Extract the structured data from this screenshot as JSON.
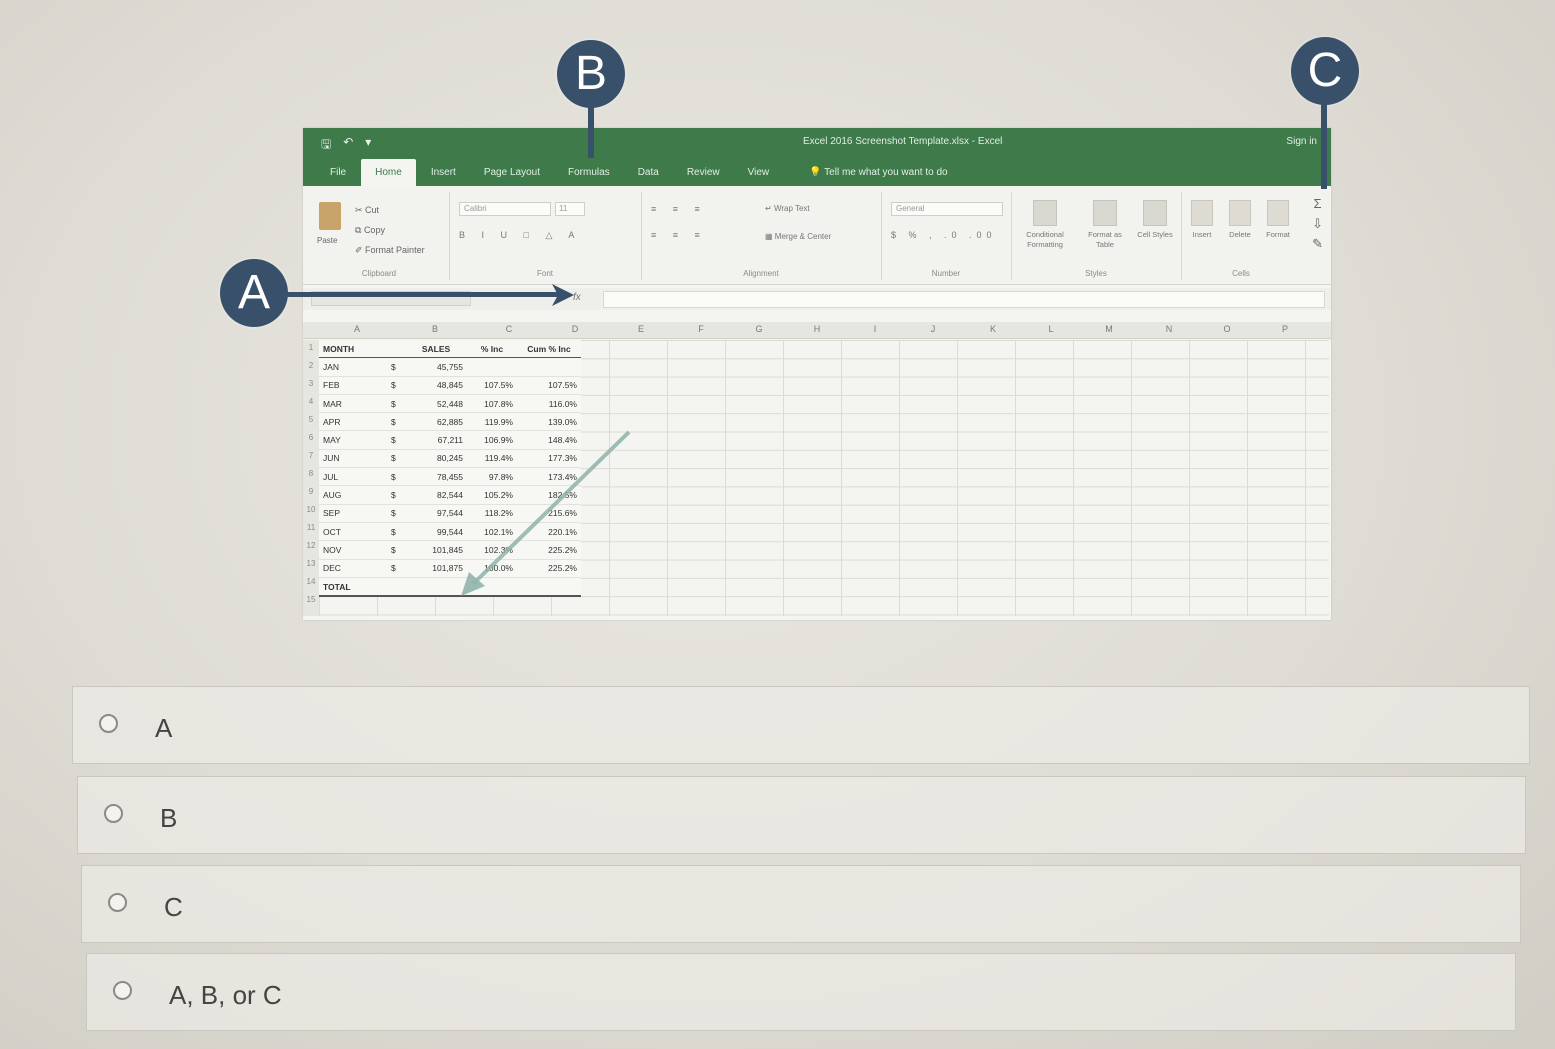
{
  "excel": {
    "doc_title": "Excel 2016 Screenshot Template.xlsx - Excel",
    "signin": "Sign in",
    "tabs": [
      "File",
      "Home",
      "Insert",
      "Page Layout",
      "Formulas",
      "Data",
      "Review",
      "View"
    ],
    "tell_me": "Tell me what you want to do",
    "ribbon": {
      "clipboard": {
        "label": "Clipboard",
        "paste": "Paste",
        "cut": "Cut",
        "copy": "Copy",
        "format_painter": "Format Painter"
      },
      "font": {
        "label": "Font",
        "name": "Calibri",
        "size": "11"
      },
      "alignment": {
        "label": "Alignment",
        "wrap": "Wrap Text",
        "merge": "Merge & Center"
      },
      "number": {
        "label": "Number",
        "format": "General"
      },
      "styles": {
        "label": "Styles",
        "conditional": "Conditional Formatting",
        "format_table": "Format as Table",
        "cell_styles": "Cell Styles"
      },
      "cells": {
        "label": "Cells",
        "insert": "Insert",
        "delete": "Delete",
        "format": "Format"
      }
    },
    "fx": "fx",
    "columns": [
      "A",
      "B",
      "C",
      "D",
      "E",
      "F",
      "G",
      "H",
      "I",
      "J",
      "K",
      "L",
      "M",
      "N",
      "O",
      "P"
    ],
    "headers": {
      "month": "MONTH",
      "sales": "SALES",
      "inc": "% Inc",
      "cum": "Cum % Inc"
    },
    "rows": [
      {
        "month": "JAN",
        "cur": "$",
        "sales": "45,755",
        "inc": "",
        "cum": ""
      },
      {
        "month": "FEB",
        "cur": "$",
        "sales": "48,845",
        "inc": "107.5%",
        "cum": "107.5%"
      },
      {
        "month": "MAR",
        "cur": "$",
        "sales": "52,448",
        "inc": "107.8%",
        "cum": "116.0%"
      },
      {
        "month": "APR",
        "cur": "$",
        "sales": "62,885",
        "inc": "119.9%",
        "cum": "139.0%"
      },
      {
        "month": "MAY",
        "cur": "$",
        "sales": "67,211",
        "inc": "106.9%",
        "cum": "148.4%"
      },
      {
        "month": "JUN",
        "cur": "$",
        "sales": "80,245",
        "inc": "119.4%",
        "cum": "177.3%"
      },
      {
        "month": "JUL",
        "cur": "$",
        "sales": "78,455",
        "inc": "97.8%",
        "cum": "173.4%"
      },
      {
        "month": "AUG",
        "cur": "$",
        "sales": "82,544",
        "inc": "105.2%",
        "cum": "182.5%"
      },
      {
        "month": "SEP",
        "cur": "$",
        "sales": "97,544",
        "inc": "118.2%",
        "cum": "215.6%"
      },
      {
        "month": "OCT",
        "cur": "$",
        "sales": "99,544",
        "inc": "102.1%",
        "cum": "220.1%"
      },
      {
        "month": "NOV",
        "cur": "$",
        "sales": "101,845",
        "inc": "102.3%",
        "cum": "225.2%"
      },
      {
        "month": "DEC",
        "cur": "$",
        "sales": "101,875",
        "inc": "100.0%",
        "cum": "225.2%"
      }
    ],
    "total_label": "TOTAL"
  },
  "callouts": {
    "a": "A",
    "b": "B",
    "c": "C"
  },
  "options": [
    "A",
    "B",
    "C",
    "A, B, or C"
  ],
  "colors": {
    "excel_green": "#3f7a4b",
    "callout": "#39506b",
    "arrow_teal": "#8fb3ad"
  }
}
